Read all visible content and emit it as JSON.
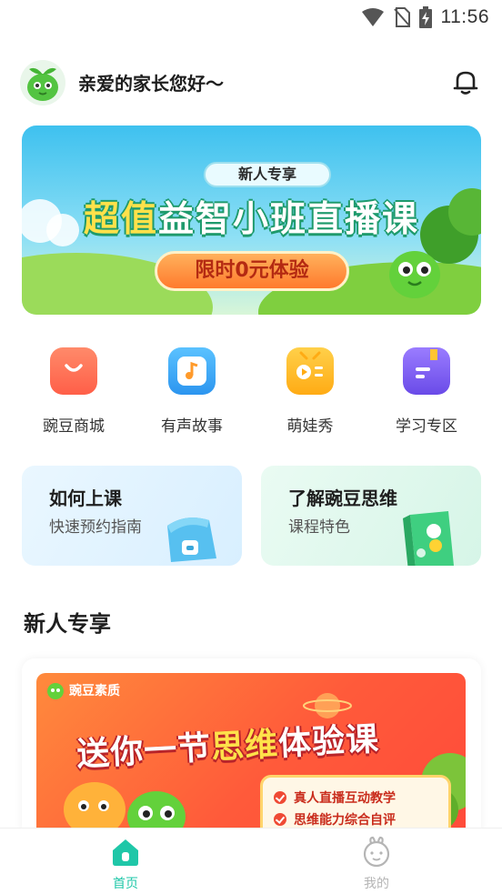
{
  "status_bar": {
    "time": "11:56",
    "icons": [
      "wifi-icon",
      "no-sim-icon",
      "battery-charging-icon"
    ]
  },
  "header": {
    "greeting": "亲爱的家长您好～",
    "avatar_icon": "pea-mascot-avatar",
    "notification_icon": "bell-icon"
  },
  "banner": {
    "tag": "新人专享",
    "title_highlight": "超值",
    "title_rest": "益智小班直播课",
    "cta": "限时0元体验"
  },
  "quick_nav": [
    {
      "label": "豌豆商城",
      "icon": "shopping-bag-icon",
      "color": "#ff6a4f"
    },
    {
      "label": "有声故事",
      "icon": "music-note-icon",
      "color": "#3aa8f5"
    },
    {
      "label": "萌娃秀",
      "icon": "play-video-icon",
      "color": "#ffb21f"
    },
    {
      "label": "学习专区",
      "icon": "book-icon",
      "color": "#7a5cf2"
    }
  ],
  "cards": [
    {
      "title": "如何上课",
      "subtitle": "快速预约指南",
      "icon": "backpack-icon"
    },
    {
      "title": "了解豌豆思维",
      "subtitle": "课程特色",
      "icon": "notebook-icon"
    }
  ],
  "section": {
    "title": "新人专享"
  },
  "promo": {
    "brand": "豌豆素质",
    "title_a": "送你一节",
    "title_highlight": "思维",
    "title_b": "体验课",
    "features": [
      "真人直播互动教学",
      "思维能力综合自评"
    ]
  },
  "bottom_nav": [
    {
      "label": "首页",
      "icon": "home-icon",
      "active": true
    },
    {
      "label": "我的",
      "icon": "profile-icon",
      "active": false
    }
  ],
  "colors": {
    "accent": "#1fc7a8",
    "inactive": "#b5b5b5"
  }
}
